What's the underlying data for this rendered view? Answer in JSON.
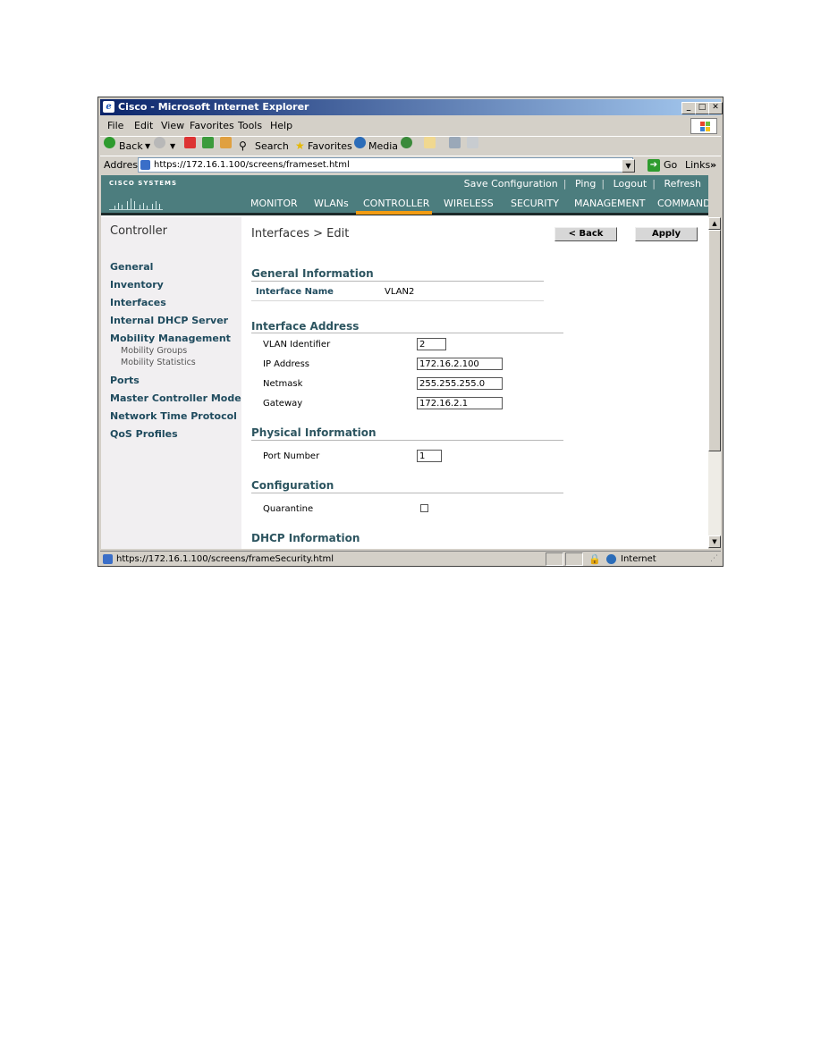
{
  "window": {
    "title": "Cisco - Microsoft Internet Explorer"
  },
  "menu": {
    "file": "File",
    "edit": "Edit",
    "view": "View",
    "favorites": "Favorites",
    "tools": "Tools",
    "help": "Help"
  },
  "toolbar": {
    "back": "Back",
    "search": "Search",
    "favorites": "Favorites",
    "media": "Media"
  },
  "address": {
    "label": "Address",
    "url": "https://172.16.1.100/screens/frameset.html",
    "go": "Go",
    "links": "Links",
    "links_chevron": "»"
  },
  "header": {
    "logo_text": "CISCO SYSTEMS",
    "links": [
      "Save Configuration",
      "Ping",
      "Logout",
      "Refresh"
    ],
    "nav": [
      "MONITOR",
      "WLANs",
      "CONTROLLER",
      "WIRELESS",
      "SECURITY",
      "MANAGEMENT",
      "COMMANDS"
    ],
    "active_nav": "CONTROLLER",
    "colors": {
      "header_bg": "#4c7d7e",
      "active_tab": "#f39c12",
      "sidebar_bg": "#f1eff1",
      "link_text": "#1f4b5e"
    }
  },
  "sidebar": {
    "heading": "Controller",
    "items": [
      "General",
      "Inventory",
      "Interfaces",
      "Internal DHCP Server",
      "Mobility Management",
      "Ports",
      "Master Controller Mode",
      "Network Time Protocol",
      "QoS Profiles"
    ],
    "subitems": [
      "Mobility Groups",
      "Mobility Statistics"
    ]
  },
  "page": {
    "title": "Interfaces > Edit",
    "back_button": "< Back",
    "apply_button": "Apply",
    "general_info": {
      "heading": "General Information",
      "interface_name_label": "Interface Name",
      "interface_name_value": "VLAN2"
    },
    "interface_address": {
      "heading": "Interface Address",
      "vlan_label": "VLAN Identifier",
      "vlan_value": "2",
      "ip_label": "IP Address",
      "ip_value": "172.16.2.100",
      "netmask_label": "Netmask",
      "netmask_value": "255.255.255.0",
      "gateway_label": "Gateway",
      "gateway_value": "172.16.2.1"
    },
    "physical_info": {
      "heading": "Physical Information",
      "port_label": "Port Number",
      "port_value": "1"
    },
    "configuration": {
      "heading": "Configuration",
      "quarantine_label": "Quarantine",
      "quarantine_checked": false
    },
    "dhcp_info": {
      "heading": "DHCP Information"
    }
  },
  "status": {
    "url": "https://172.16.1.100/screens/frameSecurity.html",
    "zone": "Internet"
  }
}
